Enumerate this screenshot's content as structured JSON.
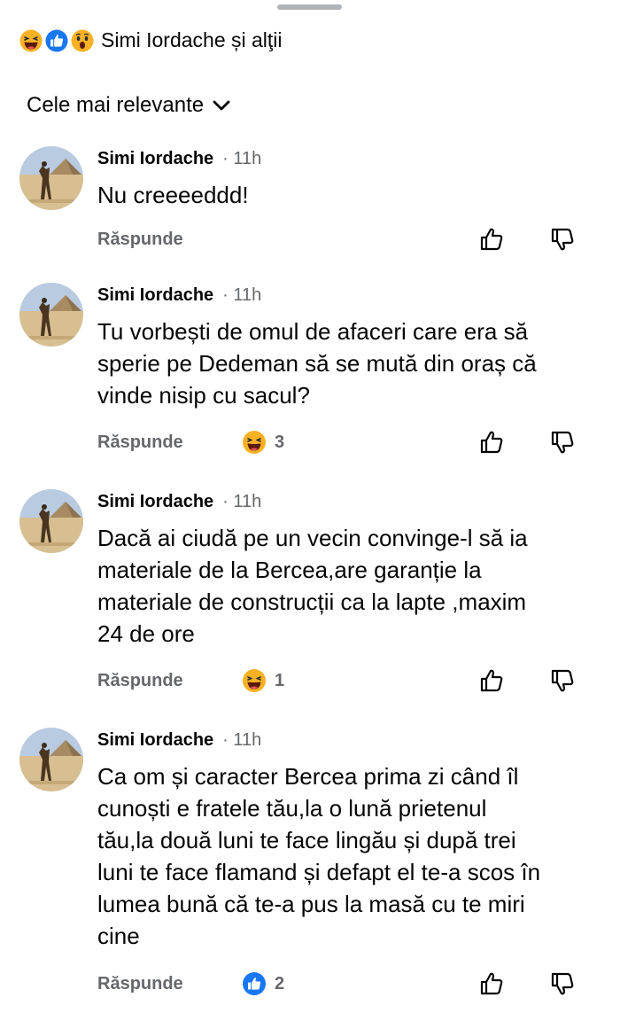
{
  "header": {
    "title": "Simi Iordache și alţii",
    "reactions": [
      "haha",
      "like",
      "wow"
    ]
  },
  "sort": {
    "label": "Cele mai relevante"
  },
  "comments": [
    {
      "author": "Simi Iordache",
      "time": "· 11h",
      "text": "Nu creeeeddd!",
      "reply_label": "Răspunde",
      "reaction": null,
      "reaction_count": ""
    },
    {
      "author": "Simi Iordache",
      "time": "· 11h",
      "text": "Tu vorbești de omul de afaceri care era să\nsperie pe Dedeman să se mută din oraș că\nvinde nisip cu sacul?",
      "reply_label": "Răspunde",
      "reaction": "haha",
      "reaction_count": "3"
    },
    {
      "author": "Simi Iordache",
      "time": "· 11h",
      "text": "Dacă ai ciudă pe un vecin convinge-l să ia\nmateriale de la Bercea,are garanție la\nmateriale de construcții ca la lapte ,maxim\n24 de ore",
      "reply_label": "Răspunde",
      "reaction": "haha",
      "reaction_count": "1"
    },
    {
      "author": "Simi Iordache",
      "time": "· 11h",
      "text": "Ca om și caracter Bercea prima zi când îl\ncunoști e fratele tău,la o lună prietenul\ntău,la două luni te face lingău și după trei\nluni te face flamand și defapt el te-a scos în\nlumea bună că te-a pus la masă cu te miri\ncine",
      "reply_label": "Răspunde",
      "reaction": "like",
      "reaction_count": "2"
    }
  ],
  "colors": {
    "primary_text": "#050505",
    "secondary_text": "#65676b",
    "like_blue": "#1877f2",
    "haha_yellow": "#f7b125"
  }
}
